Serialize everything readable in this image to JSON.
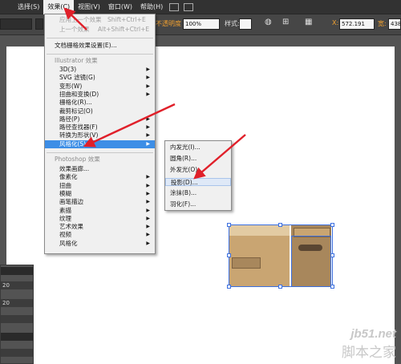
{
  "menubar": {
    "items": [
      "选择(S)",
      "效果(C)",
      "视图(V)",
      "窗口(W)",
      "帮助(H)"
    ]
  },
  "controlbar": {
    "opacity_label": "不透明度",
    "opacity_value": "100%",
    "style_label": "样式:",
    "x_value": "572.191",
    "w_value": "438"
  },
  "effect_menu": {
    "apply_last": "应用上一个效果",
    "apply_last_shortcut": "Shift+Ctrl+E",
    "last_effect": "上一个效果",
    "last_effect_shortcut": "Alt+Shift+Ctrl+E",
    "doc_raster": "文档栅格效果设置(E)...",
    "illustrator_header": "Illustrator 效果",
    "illustrator_items": [
      {
        "label": "3D(3)",
        "sub": true
      },
      {
        "label": "SVG 滤镜(G)",
        "sub": true
      },
      {
        "label": "变形(W)",
        "sub": true
      },
      {
        "label": "扭曲和变换(D)",
        "sub": true
      },
      {
        "label": "栅格化(R)...",
        "sub": false
      },
      {
        "label": "裁剪标记(O)",
        "sub": false
      },
      {
        "label": "路径(P)",
        "sub": true
      },
      {
        "label": "路径查找器(F)",
        "sub": true
      },
      {
        "label": "转换为形状(V)",
        "sub": true
      },
      {
        "label": "风格化(S)",
        "sub": true
      }
    ],
    "photoshop_header": "Photoshop 效果",
    "photoshop_items": [
      {
        "label": "效果画廊...",
        "sub": false
      },
      {
        "label": "像素化",
        "sub": true
      },
      {
        "label": "扭曲",
        "sub": true
      },
      {
        "label": "模糊",
        "sub": true
      },
      {
        "label": "画笔描边",
        "sub": true
      },
      {
        "label": "素描",
        "sub": true
      },
      {
        "label": "纹理",
        "sub": true
      },
      {
        "label": "艺术效果",
        "sub": true
      },
      {
        "label": "视频",
        "sub": true
      },
      {
        "label": "风格化",
        "sub": true
      }
    ]
  },
  "stylize_submenu": {
    "items": [
      "内发光(I)...",
      "圆角(R)...",
      "外发光(O)...",
      "投影(D)...",
      "涂抹(B)...",
      "羽化(F)..."
    ]
  },
  "left_panel": {
    "value_a": "20",
    "value_b": "20"
  },
  "watermark": {
    "en": "jb51.net",
    "cn": "脚本之家"
  },
  "colors": {
    "accent_red": "#e0202a",
    "highlight_blue": "#3d8ee6",
    "selection_blue": "#3b6fe0",
    "artwork_tan": "#c9a572",
    "artwork_dark": "#a8875c"
  }
}
